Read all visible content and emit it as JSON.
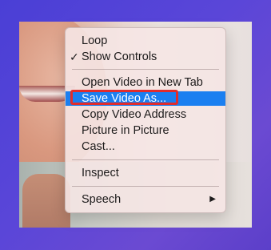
{
  "menu": {
    "items": [
      {
        "label": "Loop",
        "checked": false
      },
      {
        "label": "Show Controls",
        "checked": true,
        "check_glyph": "✓"
      },
      {
        "label": "Open Video in New Tab"
      },
      {
        "label": "Save Video As...",
        "highlighted": true
      },
      {
        "label": "Copy Video Address"
      },
      {
        "label": "Picture in Picture"
      },
      {
        "label": "Cast..."
      },
      {
        "label": "Inspect"
      },
      {
        "label": "Speech",
        "submenu": true,
        "arrow_glyph": "▶"
      }
    ]
  },
  "colors": {
    "highlight": "#1a7ff0",
    "annotation_box": "#e12c2c",
    "background": "#4a3fd6"
  }
}
